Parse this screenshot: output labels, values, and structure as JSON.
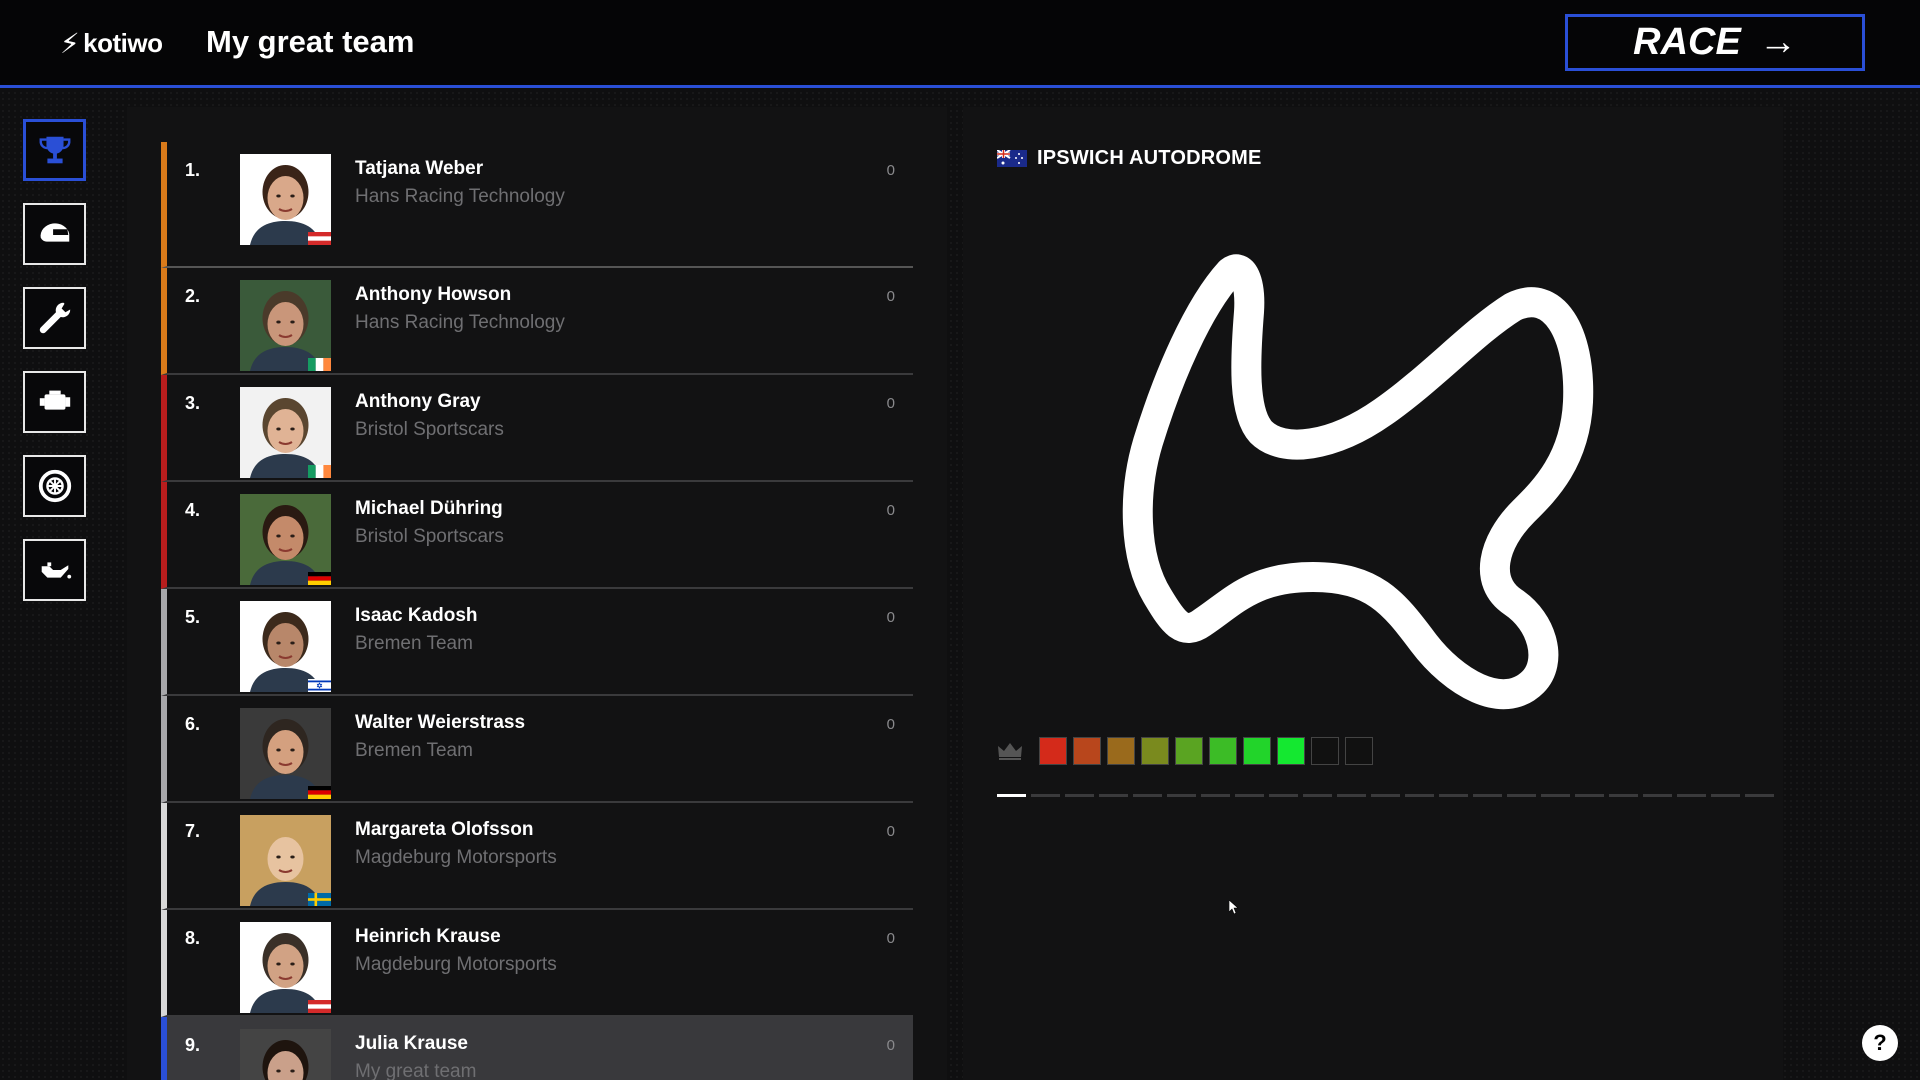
{
  "header": {
    "logo_text": "kotiwo",
    "logo_icon": "kotiwo-logo-icon",
    "team_title": "My great team",
    "race_label": "RACE",
    "race_arrow": "→"
  },
  "colors": {
    "accent": "#2a4fd6",
    "position_colors": [
      "#d97a1a",
      "#d97a1a",
      "#b81d1d",
      "#b81d1d",
      "#a8a8ab",
      "#a8a8ab",
      "#d8d8d8",
      "#d8d8d8",
      "#2a4fd6"
    ]
  },
  "sidebar": {
    "items": [
      {
        "icon": "trophy-icon",
        "active": true
      },
      {
        "icon": "helmet-icon",
        "active": false
      },
      {
        "icon": "wrench-icon",
        "active": false
      },
      {
        "icon": "engine-icon",
        "active": false
      },
      {
        "icon": "tire-icon",
        "active": false
      },
      {
        "icon": "oil-can-icon",
        "active": false
      }
    ]
  },
  "standings": [
    {
      "pos": "1.",
      "name": "Tatjana Weber",
      "team": "Hans Racing Technology",
      "points": "0",
      "flag": "austria"
    },
    {
      "pos": "2.",
      "name": "Anthony Howson",
      "team": "Hans Racing Technology",
      "points": "0",
      "flag": "ireland"
    },
    {
      "pos": "3.",
      "name": "Anthony Gray",
      "team": "Bristol Sportscars",
      "points": "0",
      "flag": "ireland"
    },
    {
      "pos": "4.",
      "name": "Michael Dühring",
      "team": "Bristol Sportscars",
      "points": "0",
      "flag": "germany"
    },
    {
      "pos": "5.",
      "name": "Isaac Kadosh",
      "team": "Bremen Team",
      "points": "0",
      "flag": "israel"
    },
    {
      "pos": "6.",
      "name": "Walter Weierstrass",
      "team": "Bremen Team",
      "points": "0",
      "flag": "germany"
    },
    {
      "pos": "7.",
      "name": "Margareta Olofsson",
      "team": "Magdeburg Motorsports",
      "points": "0",
      "flag": "sweden"
    },
    {
      "pos": "8.",
      "name": "Heinrich Krause",
      "team": "Magdeburg Motorsports",
      "points": "0",
      "flag": "austria"
    },
    {
      "pos": "9.",
      "name": "Julia Krause",
      "team": "My great team",
      "points": "0",
      "flag": "none",
      "selected": true
    }
  ],
  "track": {
    "flag": "australia",
    "name": "IPSWICH AUTODROME",
    "rating_icon": "crown-icon",
    "rating_colors": [
      "#d42a1a",
      "#b8461c",
      "#9a6a1c",
      "#7a8a1e",
      "#5aa422",
      "#3cbc26",
      "#22d42a",
      "#14e830",
      "#111111",
      "#111111"
    ],
    "progress_total": 23,
    "progress_current": 1
  },
  "help_label": "?"
}
